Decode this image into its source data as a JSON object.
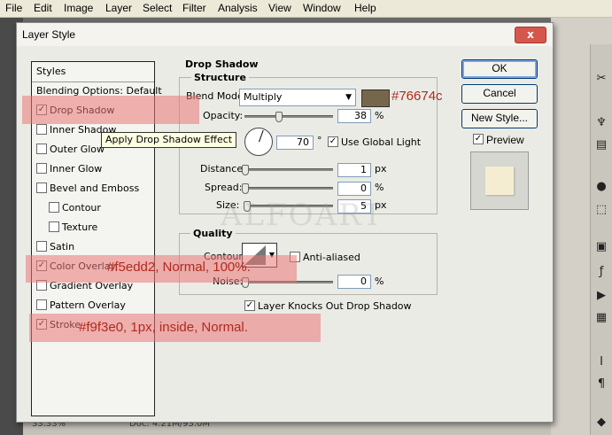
{
  "menu": [
    "File",
    "Edit",
    "Image",
    "Layer",
    "Select",
    "Filter",
    "Analysis",
    "View",
    "Window",
    "Help"
  ],
  "dialog": {
    "title": "Layer Style",
    "close_label": "x"
  },
  "styles_panel": {
    "header": "Styles",
    "blending": "Blending Options: Default",
    "items": [
      {
        "label": "Drop Shadow",
        "checked": true
      },
      {
        "label": "Inner Shadow",
        "checked": false
      },
      {
        "label": "Outer Glow",
        "checked": false
      },
      {
        "label": "Inner Glow",
        "checked": false
      },
      {
        "label": "Bevel and Emboss",
        "checked": false
      },
      {
        "label": "Contour",
        "checked": false
      },
      {
        "label": "Texture",
        "checked": false
      },
      {
        "label": "Satin",
        "checked": false
      },
      {
        "label": "Color Overlay",
        "checked": true
      },
      {
        "label": "Gradient Overlay",
        "checked": false
      },
      {
        "label": "Pattern Overlay",
        "checked": false
      },
      {
        "label": "Stroke",
        "checked": true
      }
    ]
  },
  "drop_shadow": {
    "title": "Drop Shadow",
    "structure": "Structure",
    "blend_mode_label": "Blend Mode:",
    "blend_mode_value": "Multiply",
    "shadow_color": "#76674c",
    "opacity_label": "Opacity:",
    "opacity_value": "38",
    "opacity_unit": "%",
    "angle_value": "70",
    "angle_unit": "°",
    "use_global_light": "Use Global Light",
    "use_global_light_checked": true,
    "distance_label": "Distance:",
    "distance_value": "1",
    "distance_unit": "px",
    "spread_label": "Spread:",
    "spread_value": "0",
    "spread_unit": "%",
    "size_label": "Size:",
    "size_value": "5",
    "size_unit": "px",
    "quality": "Quality",
    "contour_label": "Contour:",
    "anti_aliased": "Anti-aliased",
    "noise_label": "Noise:",
    "noise_value": "0",
    "noise_unit": "%",
    "layer_knocks_out": "Layer Knocks Out Drop Shadow",
    "layer_knocks_out_checked": true
  },
  "buttons": {
    "ok": "OK",
    "cancel": "Cancel",
    "new_style": "New Style...",
    "preview": "Preview",
    "preview_checked": true
  },
  "preview_swatch_color": "#f5edd2",
  "tooltip": "Apply Drop Shadow Effect",
  "annotations": {
    "drop_shadow": "#76674c",
    "color_overlay": "#f5edd2, Normal, 100%.",
    "stroke": "#f9f3e0, 1px, inside, Normal."
  },
  "status": {
    "zoom": "33.33%",
    "doc": "Doc: 4.21M/93.0M"
  },
  "watermark": "ALFOART"
}
